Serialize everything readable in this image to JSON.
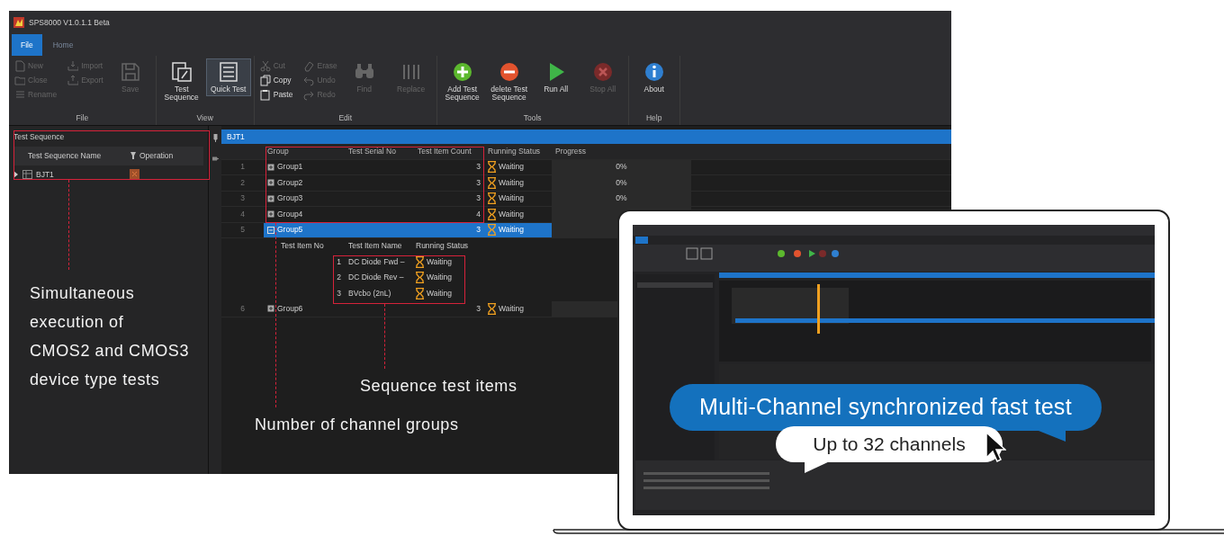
{
  "app": {
    "title": "SPS8000 V1.0.1.1 Beta",
    "tabs": [
      {
        "label": "File",
        "selected": true
      },
      {
        "label": "Home",
        "selected": false
      }
    ],
    "ribbon": [
      {
        "label": "File",
        "items": [
          {
            "label": "New",
            "kind": "small",
            "disabled": true,
            "pressed": false
          },
          {
            "label": "Close",
            "kind": "small",
            "disabled": true,
            "pressed": false
          },
          {
            "label": "Rename",
            "kind": "small",
            "disabled": true,
            "pressed": false
          },
          {
            "label": "Import",
            "kind": "small",
            "disabled": true,
            "pressed": false
          },
          {
            "label": "Export",
            "kind": "small",
            "disabled": true,
            "pressed": false
          },
          {
            "label": "Save",
            "kind": "large",
            "disabled": true,
            "pressed": false
          }
        ]
      },
      {
        "label": "View",
        "items": [
          {
            "label": "Test Sequence",
            "kind": "large",
            "disabled": false,
            "pressed": false
          },
          {
            "label": "Quick Test",
            "kind": "large",
            "disabled": false,
            "pressed": true
          }
        ]
      },
      {
        "label": "Edit",
        "items": [
          {
            "label": "Cut",
            "kind": "small",
            "disabled": true,
            "pressed": false
          },
          {
            "label": "Copy",
            "kind": "small",
            "disabled": false,
            "pressed": false
          },
          {
            "label": "Paste",
            "kind": "small",
            "disabled": false,
            "pressed": false
          },
          {
            "label": "Erase",
            "kind": "small",
            "disabled": true,
            "pressed": false
          },
          {
            "label": "Undo",
            "kind": "small",
            "disabled": true,
            "pressed": false
          },
          {
            "label": "Redo",
            "kind": "small",
            "disabled": true,
            "pressed": false
          },
          {
            "label": "Find",
            "kind": "large",
            "disabled": true,
            "pressed": false
          },
          {
            "label": "Replace",
            "kind": "large",
            "disabled": true,
            "pressed": false
          }
        ]
      },
      {
        "label": "Tools",
        "items": [
          {
            "label": "Add Test Sequence",
            "kind": "large",
            "disabled": false,
            "pressed": false
          },
          {
            "label": "delete Test Sequence",
            "kind": "large",
            "disabled": false,
            "pressed": false
          },
          {
            "label": "Run All",
            "kind": "large",
            "disabled": false,
            "pressed": false
          },
          {
            "label": "Stop All",
            "kind": "large",
            "disabled": true,
            "pressed": false
          }
        ]
      },
      {
        "label": "Help",
        "items": [
          {
            "label": "About",
            "kind": "large",
            "disabled": false,
            "pressed": false
          }
        ]
      }
    ],
    "sequence_panel": {
      "title": "Test Sequence",
      "columns": [
        "Test Sequence Name",
        "Operation"
      ],
      "rows": [
        {
          "name": "BJT1"
        }
      ]
    },
    "document_tab": "BJT1",
    "grid": {
      "columns": [
        "Group",
        "Test Serial No",
        "Test Item Count",
        "Running Status",
        "Progress"
      ],
      "rows": [
        {
          "number": "1",
          "name": "Group1",
          "count": "3",
          "status": "Waiting",
          "progress": "0%",
          "expanded": false,
          "selected": false
        },
        {
          "number": "2",
          "name": "Group2",
          "count": "3",
          "status": "Waiting",
          "progress": "0%",
          "expanded": false,
          "selected": false
        },
        {
          "number": "3",
          "name": "Group3",
          "count": "3",
          "status": "Waiting",
          "progress": "0%",
          "expanded": false,
          "selected": false
        },
        {
          "number": "4",
          "name": "Group4",
          "count": "4",
          "status": "Waiting",
          "expanded": false,
          "selected": false
        },
        {
          "number": "5",
          "name": "Group5",
          "count": "3",
          "status": "Waiting",
          "expanded": true,
          "selected": true,
          "details": {
            "columns": [
              "Test Item No",
              "Test Item Name",
              "Running Status"
            ],
            "rows": [
              {
                "number": "1",
                "name": "DC Diode Fwd –",
                "status": "Waiting"
              },
              {
                "number": "2",
                "name": "DC Diode Rev –",
                "status": "Waiting"
              },
              {
                "number": "3",
                "name": "BVcbo (2nL)",
                "status": "Waiting"
              }
            ]
          }
        },
        {
          "number": "6",
          "name": "Group6",
          "count": "3",
          "status": "Waiting",
          "expanded": false,
          "selected": false
        }
      ]
    }
  },
  "annotations": [
    {
      "kind": "left",
      "text": "Simultaneous\nexecution of\nCMOS2 and CMOS3\ndevice type tests"
    },
    {
      "kind": "items",
      "text": "Sequence test items"
    },
    {
      "kind": "groups",
      "text": "Number of channel groups"
    }
  ],
  "laptop": {
    "headline": "Multi-Channel synchronized fast test",
    "subline": "Up to 32 channels"
  }
}
